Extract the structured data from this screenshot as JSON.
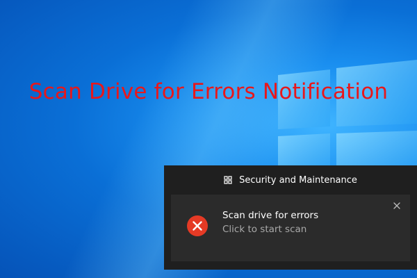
{
  "page": {
    "headline": "Scan Drive for Errors Notification"
  },
  "action_center": {
    "app_name": "Security and Maintenance",
    "app_icon": "security-maintenance-icon",
    "notification": {
      "title": "Scan drive for errors",
      "subtitle": "Click to start scan",
      "status_icon": "error-icon",
      "close_icon": "close-icon"
    }
  },
  "colors": {
    "headline": "#e8171b",
    "error_badge": "#e53a25",
    "panel_bg": "#1f1f1f",
    "toast_bg": "#2b2b2b",
    "subtitle_text": "#a9a9a9"
  }
}
